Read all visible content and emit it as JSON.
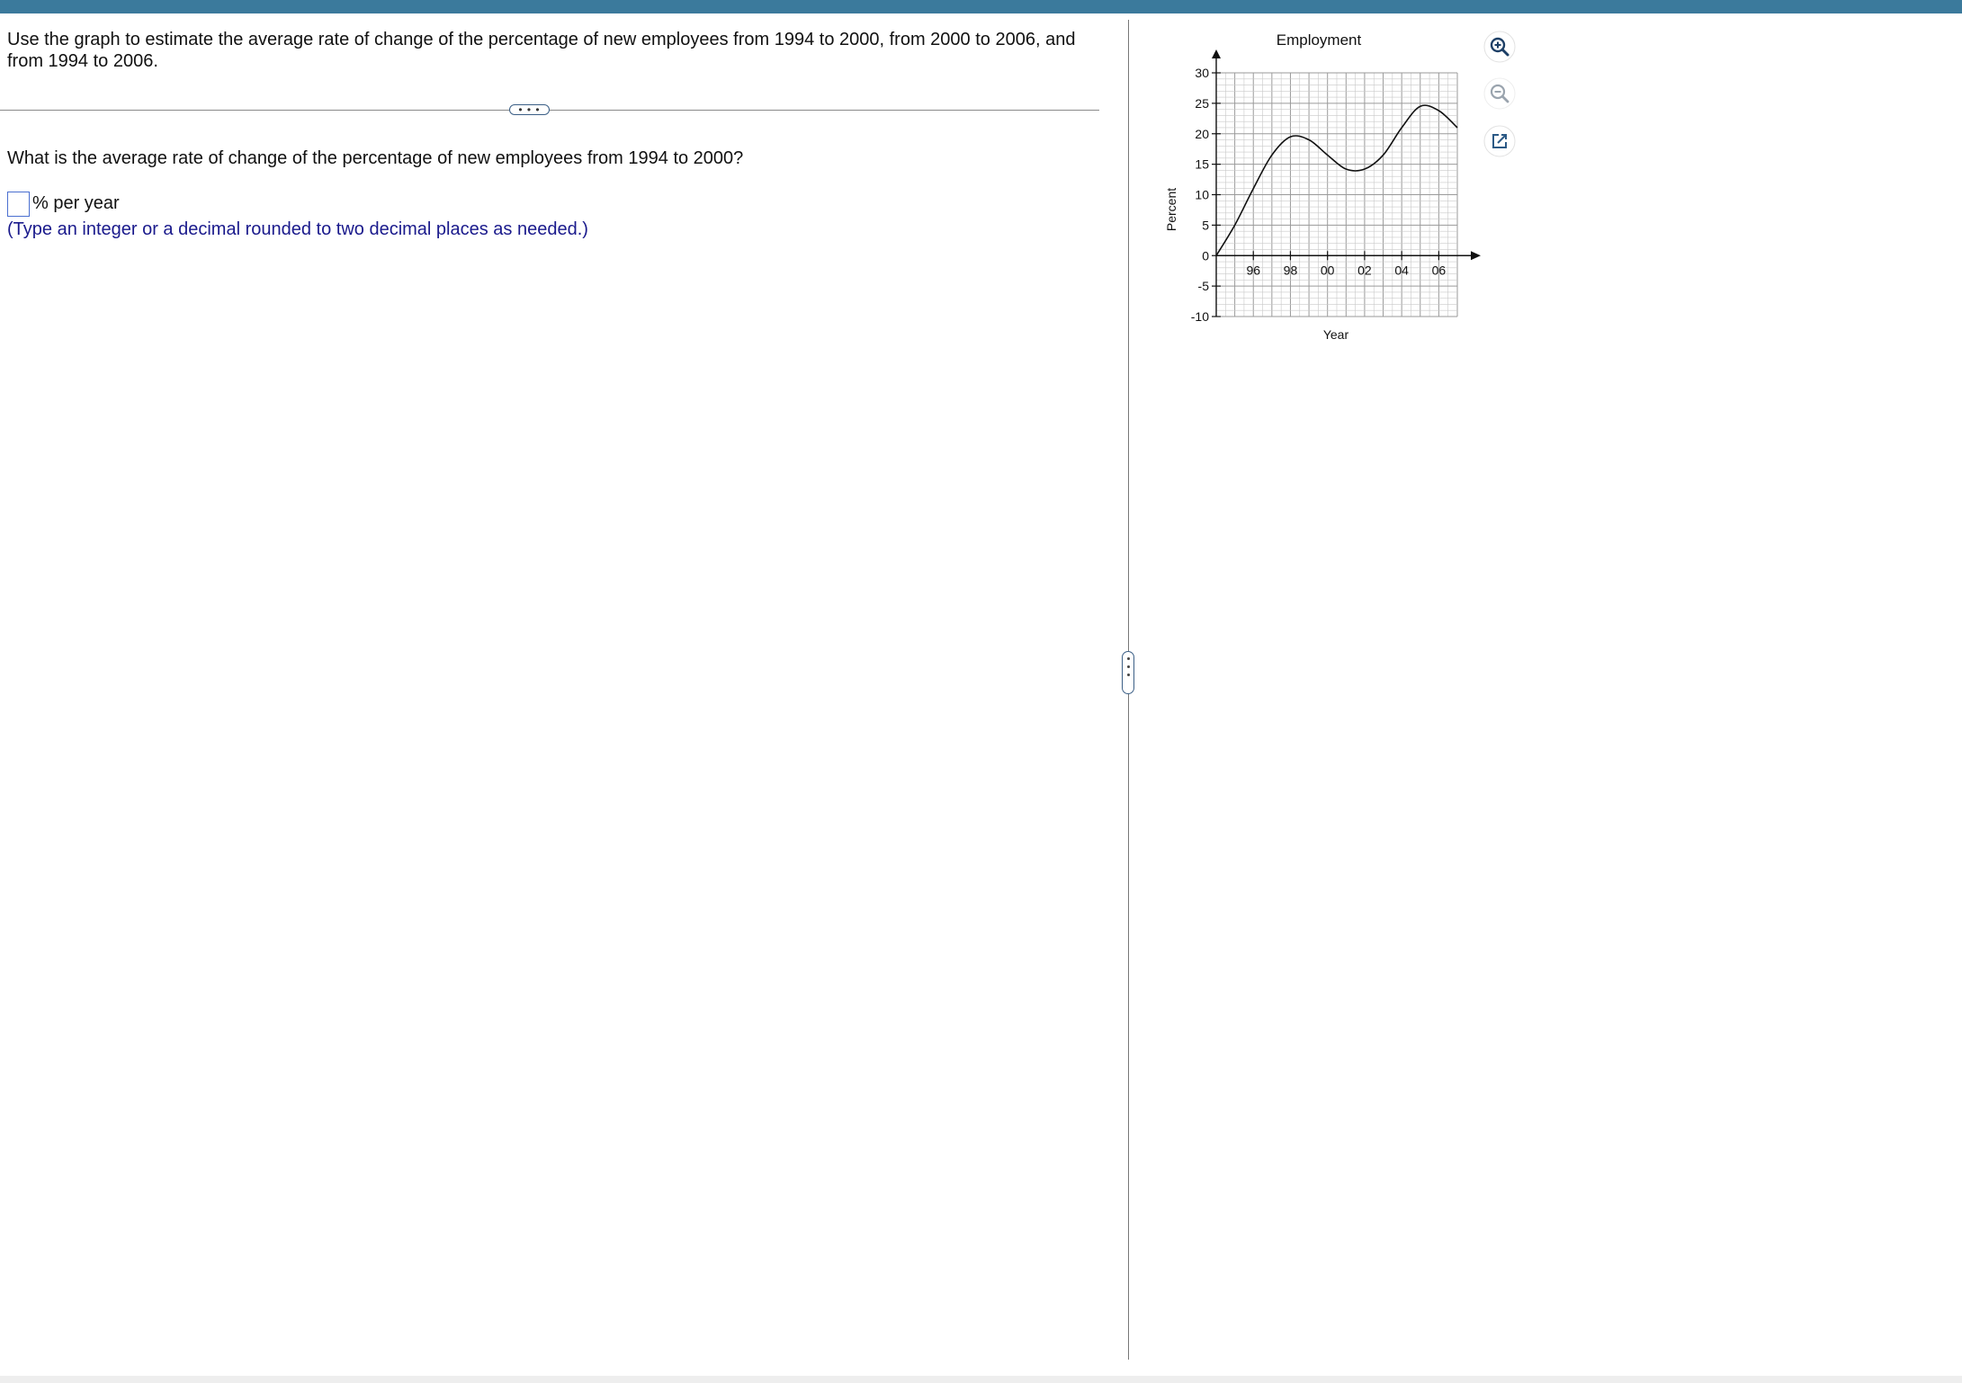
{
  "question": {
    "intro": "Use the graph to estimate the average rate of change of the percentage of new employees from 1994 to 2000, from 2000 to 2006, and from 1994 to 2006.",
    "expand_label": "• • •",
    "sub_question": "What is the average rate of change of the percentage of new employees from 1994 to 2000?",
    "answer_value": "",
    "answer_unit": "% per year",
    "hint": "(Type an integer or a decimal rounded to two decimal places as needed.)"
  },
  "toolbar": {
    "zoom_in_icon": "zoom-in-icon",
    "zoom_out_icon": "zoom-out-icon",
    "open_external_icon": "open-external-icon"
  },
  "colors": {
    "topbar": "#3b7a9c",
    "hint_text": "#1a1a8c",
    "input_border": "#4a6fd0"
  },
  "chart_data": {
    "type": "line",
    "title": "Employment",
    "xlabel": "Year",
    "ylabel": "Percent",
    "x_ticks": [
      1996,
      1998,
      2000,
      2002,
      2004,
      2006
    ],
    "x_tick_labels": [
      "96",
      "98",
      "00",
      "02",
      "04",
      "06"
    ],
    "y_ticks": [
      30,
      25,
      20,
      15,
      10,
      5,
      0,
      -5,
      -10
    ],
    "y_tick_labels": [
      "30",
      "25",
      "20",
      "15",
      "10",
      "5",
      "0",
      "-5",
      "-10"
    ],
    "xlim": [
      1994,
      2007
    ],
    "ylim": [
      -10,
      30
    ],
    "grid": true,
    "series": [
      {
        "x": [
          1994,
          1995,
          1996,
          1997,
          1998,
          1999,
          2000,
          2001,
          2002,
          2003,
          2004,
          2005,
          2006,
          2007
        ],
        "values": [
          0,
          5,
          11,
          16.5,
          19.5,
          19,
          16.5,
          14.2,
          14.2,
          16.5,
          21,
          24.5,
          23.8,
          21
        ]
      }
    ]
  }
}
